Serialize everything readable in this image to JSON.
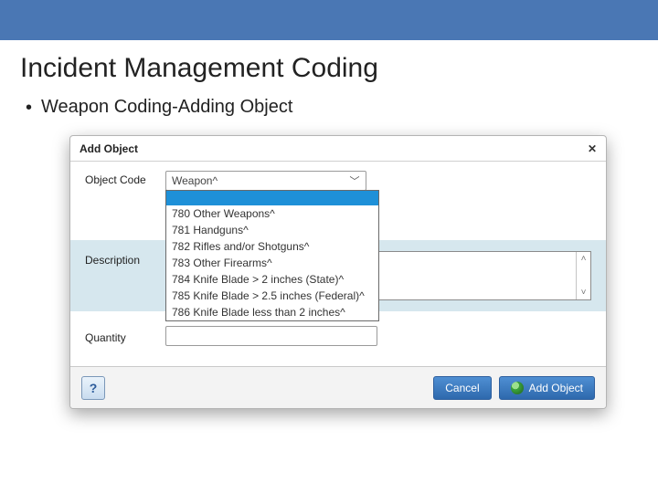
{
  "slide": {
    "title": "Incident Management Coding",
    "bullet": "Weapon Coding-Adding Object"
  },
  "dialog": {
    "title": "Add Object",
    "close": "✕",
    "labels": {
      "object_code": "Object Code",
      "description": "Description",
      "quantity": "Quantity"
    },
    "select_value": "Weapon^",
    "options": [
      "780 Other Weapons^",
      "781 Handguns^",
      "782 Rifles and/or Shotguns^",
      "783 Other Firearms^",
      "784 Knife Blade > 2 inches (State)^",
      "785 Knife Blade > 2.5 inches (Federal)^",
      "786 Knife Blade less than 2 inches^"
    ],
    "buttons": {
      "help": "?",
      "cancel": "Cancel",
      "add": "Add Object"
    }
  }
}
